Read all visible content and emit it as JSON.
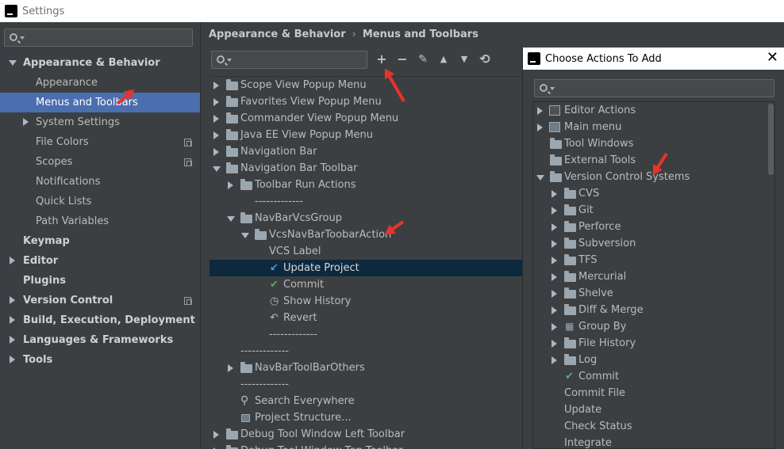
{
  "window": {
    "title": "Settings"
  },
  "left_nav": {
    "search_placeholder": "",
    "items": [
      {
        "label": "Appearance & Behavior"
      },
      {
        "label": "Appearance"
      },
      {
        "label": "Menus and Toolbars"
      },
      {
        "label": "System Settings"
      },
      {
        "label": "File Colors"
      },
      {
        "label": "Scopes"
      },
      {
        "label": "Notifications"
      },
      {
        "label": "Quick Lists"
      },
      {
        "label": "Path Variables"
      },
      {
        "label": "Keymap"
      },
      {
        "label": "Editor"
      },
      {
        "label": "Plugins"
      },
      {
        "label": "Version Control"
      },
      {
        "label": "Build, Execution, Deployment"
      },
      {
        "label": "Languages & Frameworks"
      },
      {
        "label": "Tools"
      }
    ]
  },
  "breadcrumb": {
    "parent": "Appearance & Behavior",
    "sep": "›",
    "current": "Menus and Toolbars"
  },
  "toolbar": {
    "add": "+",
    "remove": "−",
    "edit": "✎",
    "up": "▲",
    "down": "▼",
    "restore": "⟲"
  },
  "menu_tree": [
    {
      "label": "Scope View Popup Menu"
    },
    {
      "label": "Favorites View Popup Menu"
    },
    {
      "label": "Commander View Popup Menu"
    },
    {
      "label": "Java EE View Popup Menu"
    },
    {
      "label": "Navigation Bar"
    },
    {
      "label": "Navigation Bar Toolbar"
    },
    {
      "label": "Toolbar Run Actions"
    },
    {
      "label": "-------------"
    },
    {
      "label": "NavBarVcsGroup"
    },
    {
      "label": "VcsNavBarToobarAction"
    },
    {
      "label": "VCS Label"
    },
    {
      "label": "Update Project"
    },
    {
      "label": "Commit"
    },
    {
      "label": "Show History"
    },
    {
      "label": "Revert"
    },
    {
      "label": "-------------"
    },
    {
      "label": "-------------"
    },
    {
      "label": "NavBarToolBarOthers"
    },
    {
      "label": "-------------"
    },
    {
      "label": "Search Everywhere"
    },
    {
      "label": "Project Structure..."
    },
    {
      "label": "Debug Tool Window Left Toolbar"
    },
    {
      "label": "Debug Tool Window Top Toolbar"
    }
  ],
  "dialog": {
    "title": "Choose Actions To Add",
    "close": "✕",
    "search_placeholder": "",
    "items": [
      {
        "label": "Editor Actions"
      },
      {
        "label": "Main menu"
      },
      {
        "label": "Tool Windows"
      },
      {
        "label": "External Tools"
      },
      {
        "label": "Version Control Systems"
      },
      {
        "label": "CVS"
      },
      {
        "label": "Git"
      },
      {
        "label": "Perforce"
      },
      {
        "label": "Subversion"
      },
      {
        "label": "TFS"
      },
      {
        "label": "Mercurial"
      },
      {
        "label": "Shelve"
      },
      {
        "label": "Diff & Merge"
      },
      {
        "label": "Group By"
      },
      {
        "label": "File History"
      },
      {
        "label": "Log"
      },
      {
        "label": "Commit"
      },
      {
        "label": "Commit File"
      },
      {
        "label": "Update"
      },
      {
        "label": "Check Status"
      },
      {
        "label": "Integrate"
      }
    ]
  },
  "colors": {
    "background": "#3c3f41",
    "selection": "#4b6eaf",
    "selection_dark": "#0d293e",
    "annotation_arrow": "#e8332a"
  }
}
